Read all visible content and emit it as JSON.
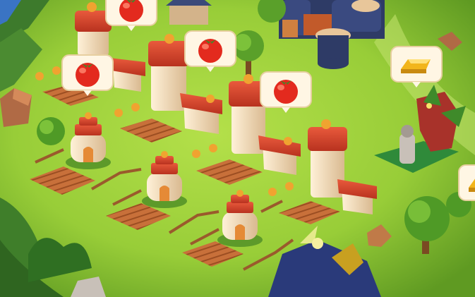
{
  "scene": {
    "colors": {
      "grass_light": "#9cd13c",
      "grass_dark": "#6aa524",
      "soil": "#c46a35",
      "roof_red": "#d9452f",
      "wall_cream": "#f3e2c6",
      "bubble_bg": "#fff6e4",
      "tomato": "#e32a1e",
      "gold": "#f2b51c"
    }
  },
  "bubbles": [
    {
      "id": "tomato-1",
      "icon": "tomato-icon"
    },
    {
      "id": "tomato-2",
      "icon": "tomato-icon"
    },
    {
      "id": "tomato-3",
      "icon": "tomato-icon"
    },
    {
      "id": "tomato-4",
      "icon": "tomato-icon"
    },
    {
      "id": "gold-1",
      "icon": "gold-bar-icon"
    },
    {
      "id": "gold-2",
      "icon": "gold-bar-icon"
    }
  ]
}
